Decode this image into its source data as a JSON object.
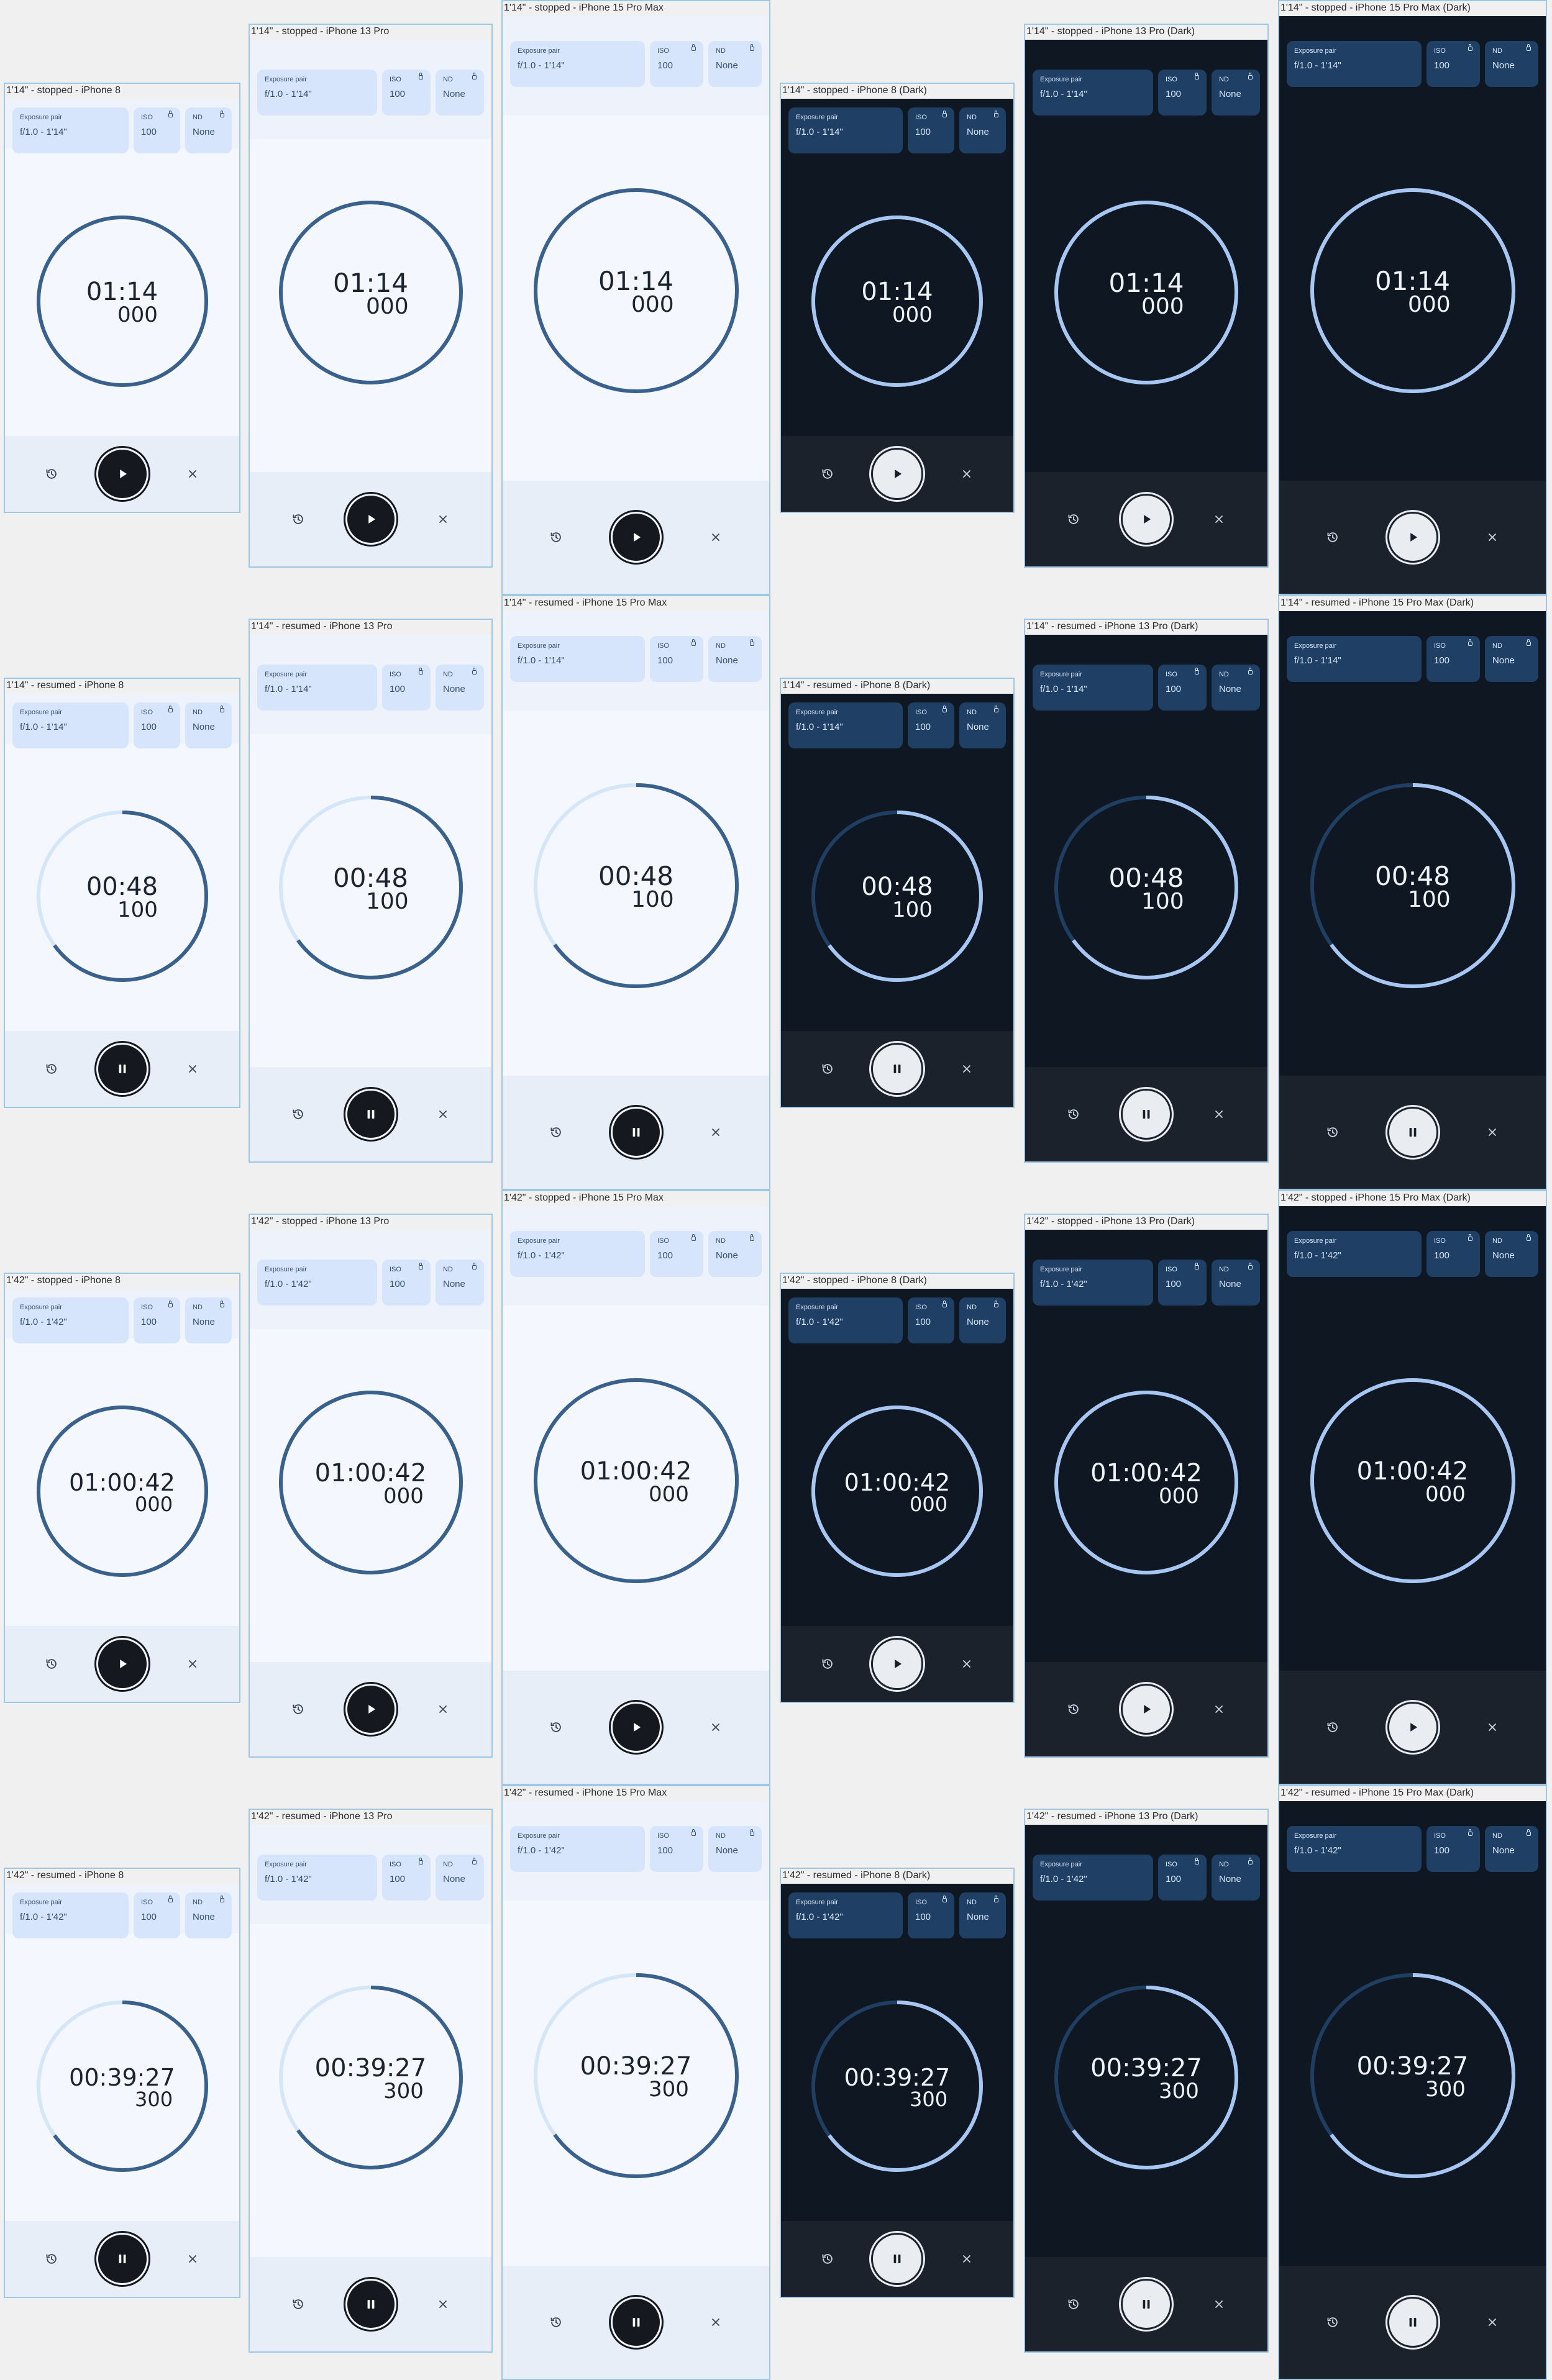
{
  "labels": {
    "exposure_pair": "Exposure pair",
    "iso": "ISO",
    "nd": "ND"
  },
  "colors": {
    "light_ring": "#3a618c",
    "light_track": "#d5e6f8",
    "dark_ring": "#a7c7f2",
    "dark_track": "#1f3e62"
  },
  "icons": {
    "left": "history-icon",
    "main_stopped": "play-icon",
    "main_resumed": "pause-icon",
    "right": "close-icon",
    "chip": "lock-icon"
  },
  "frames": [
    {
      "title": "1'14\" - stopped - iPhone 8",
      "exposure": "f/1.0 - 1'14\"",
      "iso": "100",
      "nd": "None",
      "time": "01:14",
      "ms": "000",
      "progress": 1
    },
    {
      "title": "1'14\" - stopped - iPhone 13 Pro",
      "exposure": "f/1.0 - 1'14\"",
      "iso": "100",
      "nd": "None",
      "time": "01:14",
      "ms": "000",
      "progress": 1
    },
    {
      "title": "1'14\" - stopped - iPhone 15 Pro Max",
      "exposure": "f/1.0 - 1'14\"",
      "iso": "100",
      "nd": "None",
      "time": "01:14",
      "ms": "000",
      "progress": 1
    },
    {
      "title": "1'14\" - stopped - iPhone 8 (Dark)",
      "exposure": "f/1.0 - 1'14\"",
      "iso": "100",
      "nd": "None",
      "time": "01:14",
      "ms": "000",
      "progress": 1
    },
    {
      "title": "1'14\" - stopped - iPhone 13 Pro (Dark)",
      "exposure": "f/1.0 - 1'14\"",
      "iso": "100",
      "nd": "None",
      "time": "01:14",
      "ms": "000",
      "progress": 1
    },
    {
      "title": "1'14\" - stopped - iPhone 15 Pro Max (Dark)",
      "exposure": "f/1.0 - 1'14\"",
      "iso": "100",
      "nd": "None",
      "time": "01:14",
      "ms": "000",
      "progress": 1
    },
    {
      "title": "1'14\" - resumed - iPhone 8",
      "exposure": "f/1.0 - 1'14\"",
      "iso": "100",
      "nd": "None",
      "time": "00:48",
      "ms": "100",
      "progress": 0.65
    },
    {
      "title": "1'14\" - resumed - iPhone 13 Pro",
      "exposure": "f/1.0 - 1'14\"",
      "iso": "100",
      "nd": "None",
      "time": "00:48",
      "ms": "100",
      "progress": 0.65
    },
    {
      "title": "1'14\" - resumed - iPhone 15 Pro Max",
      "exposure": "f/1.0 - 1'14\"",
      "iso": "100",
      "nd": "None",
      "time": "00:48",
      "ms": "100",
      "progress": 0.65
    },
    {
      "title": "1'14\" - resumed - iPhone 8 (Dark)",
      "exposure": "f/1.0 - 1'14\"",
      "iso": "100",
      "nd": "None",
      "time": "00:48",
      "ms": "100",
      "progress": 0.65
    },
    {
      "title": "1'14\" - resumed - iPhone 13 Pro (Dark)",
      "exposure": "f/1.0 - 1'14\"",
      "iso": "100",
      "nd": "None",
      "time": "00:48",
      "ms": "100",
      "progress": 0.65
    },
    {
      "title": "1'14\" - resumed - iPhone 15 Pro Max (Dark)",
      "exposure": "f/1.0 - 1'14\"",
      "iso": "100",
      "nd": "None",
      "time": "00:48",
      "ms": "100",
      "progress": 0.65
    },
    {
      "title": "1'42\" - stopped - iPhone 8",
      "exposure": "f/1.0 - 1'42\"",
      "iso": "100",
      "nd": "None",
      "time": "01:00:42",
      "ms": "000",
      "progress": 1
    },
    {
      "title": "1'42\" - stopped - iPhone 13 Pro",
      "exposure": "f/1.0 - 1'42\"",
      "iso": "100",
      "nd": "None",
      "time": "01:00:42",
      "ms": "000",
      "progress": 1
    },
    {
      "title": "1'42\" - stopped - iPhone 15 Pro Max",
      "exposure": "f/1.0 - 1'42\"",
      "iso": "100",
      "nd": "None",
      "time": "01:00:42",
      "ms": "000",
      "progress": 1
    },
    {
      "title": "1'42\" - stopped - iPhone 8 (Dark)",
      "exposure": "f/1.0 - 1'42\"",
      "iso": "100",
      "nd": "None",
      "time": "01:00:42",
      "ms": "000",
      "progress": 1
    },
    {
      "title": "1'42\" - stopped - iPhone 13 Pro (Dark)",
      "exposure": "f/1.0 - 1'42\"",
      "iso": "100",
      "nd": "None",
      "time": "01:00:42",
      "ms": "000",
      "progress": 1
    },
    {
      "title": "1'42\" - stopped - iPhone 15 Pro Max (Dark)",
      "exposure": "f/1.0 - 1'42\"",
      "iso": "100",
      "nd": "None",
      "time": "01:00:42",
      "ms": "000",
      "progress": 1
    },
    {
      "title": "1'42\" - resumed - iPhone 8",
      "exposure": "f/1.0 - 1'42\"",
      "iso": "100",
      "nd": "None",
      "time": "00:39:27",
      "ms": "300",
      "progress": 0.65
    },
    {
      "title": "1'42\" - resumed - iPhone 13 Pro",
      "exposure": "f/1.0 - 1'42\"",
      "iso": "100",
      "nd": "None",
      "time": "00:39:27",
      "ms": "300",
      "progress": 0.65
    },
    {
      "title": "1'42\" - resumed - iPhone 15 Pro Max",
      "exposure": "f/1.0 - 1'42\"",
      "iso": "100",
      "nd": "None",
      "time": "00:39:27",
      "ms": "300",
      "progress": 0.65
    },
    {
      "title": "1'42\" - resumed - iPhone 8 (Dark)",
      "exposure": "f/1.0 - 1'42\"",
      "iso": "100",
      "nd": "None",
      "time": "00:39:27",
      "ms": "300",
      "progress": 0.65
    },
    {
      "title": "1'42\" - resumed - iPhone 13 Pro (Dark)",
      "exposure": "f/1.0 - 1'42\"",
      "iso": "100",
      "nd": "None",
      "time": "00:39:27",
      "ms": "300",
      "progress": 0.65
    },
    {
      "title": "1'42\" - resumed - iPhone 15 Pro Max (Dark)",
      "exposure": "f/1.0 - 1'42\"",
      "iso": "100",
      "nd": "None",
      "time": "00:39:27",
      "ms": "300",
      "progress": 0.65
    }
  ]
}
